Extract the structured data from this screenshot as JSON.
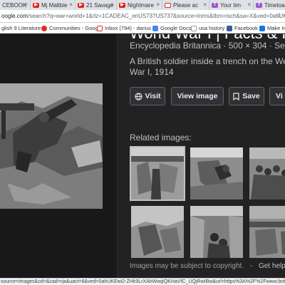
{
  "browser": {
    "tabs": [
      {
        "label": "CEBOOK",
        "icon": "facebook-icon"
      },
      {
        "label": "Mj Maltbie",
        "icon": "youtube-icon"
      },
      {
        "label": "21 Savage",
        "icon": "youtube-icon"
      },
      {
        "label": "Nightmare",
        "icon": "youtube-icon"
      },
      {
        "label": "Please ac",
        "icon": "gmail-icon"
      },
      {
        "label": "Your tim",
        "icon": "timetoast-icon"
      },
      {
        "label": "Timetoas",
        "icon": "timetoast-icon"
      }
    ],
    "url_host": "oogle.com",
    "url_path": "/search?q=war+world+1&rlz=1CADEAC_enUS737US737&source=lnms&tbm=isch&sa=X&ved=0ahUKEwi1f9Pg9Lv",
    "bookmarks": [
      {
        "label": "glish 9 Literature",
        "icon": "generic-icon"
      },
      {
        "label": "Communities - Goog",
        "icon": "communities-icon"
      },
      {
        "label": "Inbox (794) - darius",
        "icon": "gmail-icon"
      },
      {
        "label": "Google Docs",
        "icon": "docs-icon"
      },
      {
        "label": "usa history",
        "icon": "generic-icon"
      },
      {
        "label": "Facebook",
        "icon": "facebook-icon"
      },
      {
        "label": "Make Im",
        "icon": "generic-icon"
      }
    ]
  },
  "panel": {
    "title": "World War I | Facts & His",
    "source": "Encyclopedia Britannica · 500 × 304 · Se",
    "description": "A British soldier inside a trench on the We War I, 1914",
    "buttons": {
      "visit": "Visit",
      "view_image": "View image",
      "save": "Save",
      "view_saved": "Vi"
    },
    "related_label": "Related images:",
    "disclaimer": "Images may be subject to copyright.",
    "help": "Get help",
    "help_sep": "-",
    "send_feedback": "Se"
  },
  "status_url": "source=images&cd=&cad=rja&uact=8&ved=0ahUKEwi2-ZHk9LrXAhWoqIQKHaVfC_UQjRwIBw&url=https%3A%2F%2Fwww.britannica.com%2Fevent"
}
